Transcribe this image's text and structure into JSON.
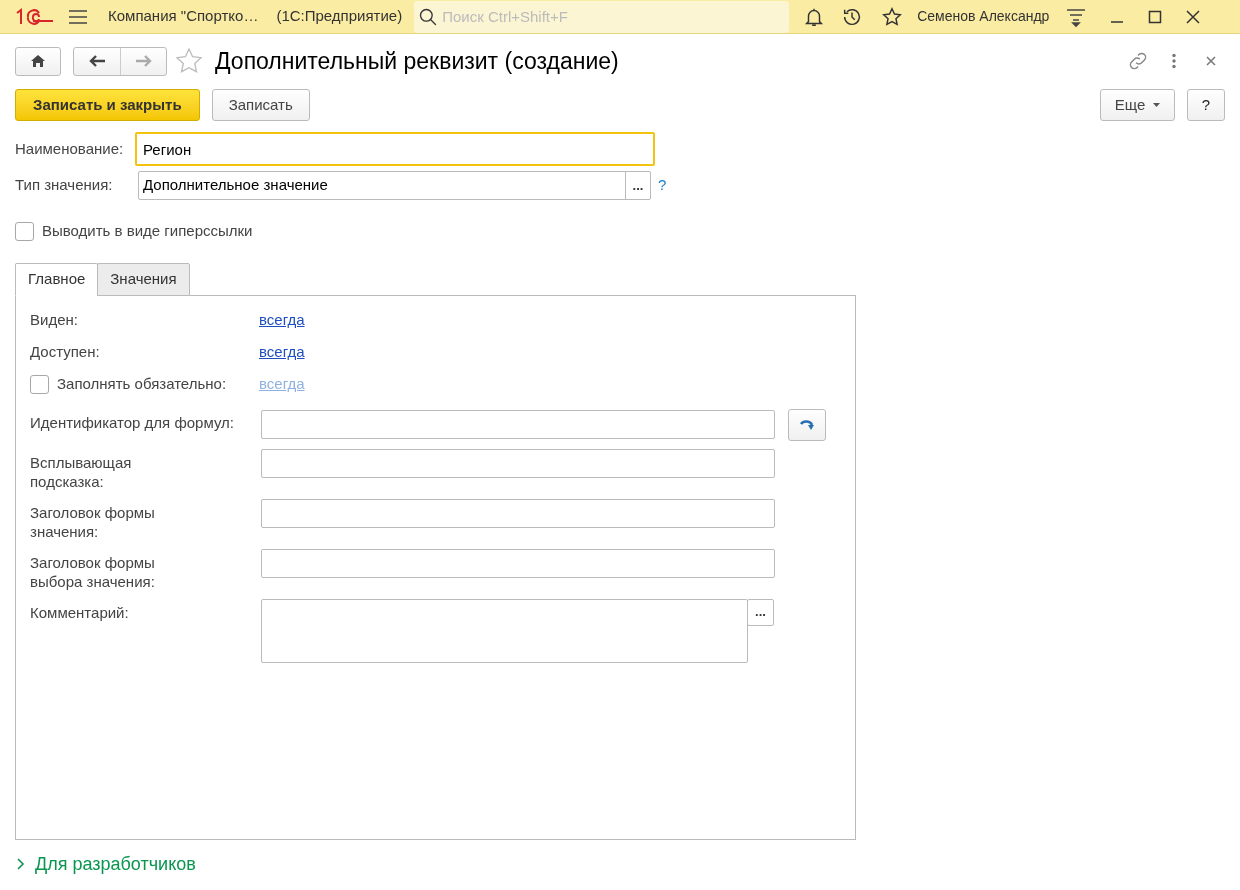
{
  "topbar": {
    "company": "Компания \"Спортко…",
    "app": "(1С:Предприятие)",
    "search": {
      "placeholder": "Поиск Ctrl+Shift+F"
    },
    "user": "Семенов Александр"
  },
  "form": {
    "title": "Дополнительный реквизит (создание)",
    "favorite": false,
    "buttons": [
      {
        "kind": "primary",
        "label": "Записать и закрыть"
      },
      {
        "kind": "secondary",
        "label": "Записать"
      }
    ],
    "more": "Еще",
    "help": "?",
    "name_field": {
      "label": "Наименование:",
      "value": "Регион",
      "focused": true
    },
    "type_field": {
      "label": "Тип значения:",
      "value": "Дополнительное значение",
      "select": "...",
      "help": "?"
    },
    "hyperlink_checkbox": {
      "label": "Выводить в виде гиперссылки",
      "checked": false
    },
    "tabs": [
      {
        "label": "Главное",
        "selected": true
      },
      {
        "label": "Значения",
        "selected": false
      }
    ],
    "settings": [
      {
        "kind": "link",
        "label": "Виден:",
        "value": "всегда",
        "disabled": false
      },
      {
        "kind": "link",
        "label": "Доступен:",
        "value": "всегда",
        "disabled": false
      },
      {
        "kind": "check_link",
        "label": "Заполнять обязательно:",
        "value": "всегда",
        "checked": false,
        "disabled": true
      }
    ],
    "fields": [
      {
        "kind": "input_button",
        "label": "Идентификатор для формул:"
      },
      {
        "kind": "input",
        "label": "Всплывающая подсказка:"
      },
      {
        "kind": "input",
        "label": "Заголовок формы значения:"
      },
      {
        "kind": "input",
        "label": "Заголовок формы выбора значения:"
      },
      {
        "kind": "textarea",
        "label": "Комментарий:",
        "button": "..."
      }
    ],
    "developers": {
      "label": "Для разработчиков",
      "expanded": false
    }
  }
}
